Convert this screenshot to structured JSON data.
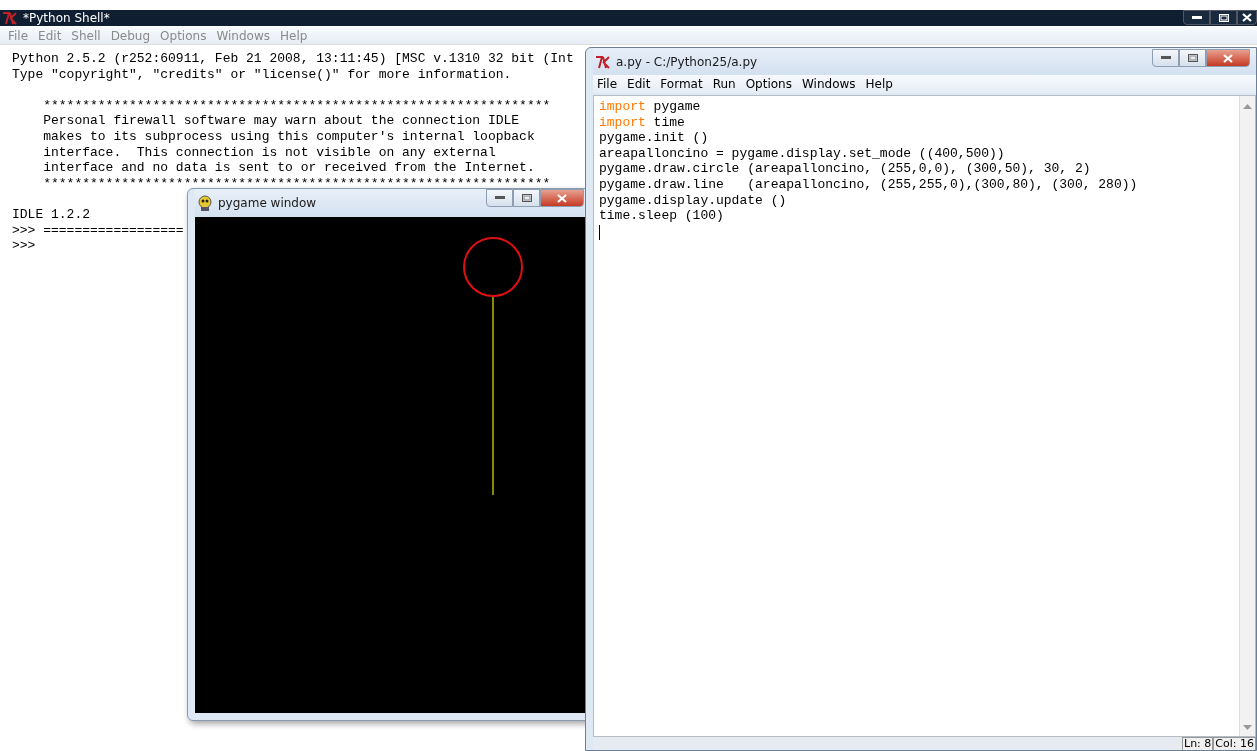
{
  "shell": {
    "title": "*Python Shell*",
    "menu": [
      "File",
      "Edit",
      "Shell",
      "Debug",
      "Options",
      "Windows",
      "Help"
    ],
    "paragraphs": [
      [
        "Python 2.5.2 (r252:60911, Feb 21 2008, 13:11:45) [MSC v.1310 32 bit (Int",
        "Type \"copyright\", \"credits\" or \"license()\" for more information."
      ],
      [
        "    *****************************************************************",
        "    Personal firewall software may warn about the connection IDLE",
        "    makes to its subprocess using this computer's internal loopback",
        "    interface.  This connection is not visible on any external",
        "    interface and no data is sent to or received from the Internet.",
        "    *****************************************************************"
      ],
      [
        "IDLE 1.2.2",
        ">>> ==================",
        ">>>"
      ]
    ]
  },
  "pygame_window": {
    "title": "pygame window"
  },
  "editor": {
    "title": "a.py - C:/Python25/a.py",
    "menu": [
      "File",
      "Edit",
      "Format",
      "Run",
      "Options",
      "Windows",
      "Help"
    ],
    "lines": [
      [
        {
          "kind": "keyword",
          "text": "import"
        },
        {
          "kind": "plain",
          "text": " pygame"
        }
      ],
      [
        {
          "kind": "keyword",
          "text": "import"
        },
        {
          "kind": "plain",
          "text": " time"
        }
      ],
      [
        {
          "kind": "plain",
          "text": "pygame.init ()"
        }
      ],
      [
        {
          "kind": "plain",
          "text": "areapalloncino = pygame.display.set_mode ((400,500))"
        }
      ],
      [
        {
          "kind": "plain",
          "text": "pygame.draw.circle (areapalloncino, (255,0,0), (300,50), 30, 2)"
        }
      ],
      [
        {
          "kind": "plain",
          "text": "pygame.draw.line   (areapalloncino, (255,255,0),(300,80), (300, 280))"
        }
      ],
      [
        {
          "kind": "plain",
          "text": "pygame.display.update ()"
        }
      ],
      [
        {
          "kind": "plain",
          "text": "time.sleep (100)"
        }
      ]
    ],
    "status": {
      "line": "Ln: 8",
      "column": "Col: 16"
    }
  }
}
